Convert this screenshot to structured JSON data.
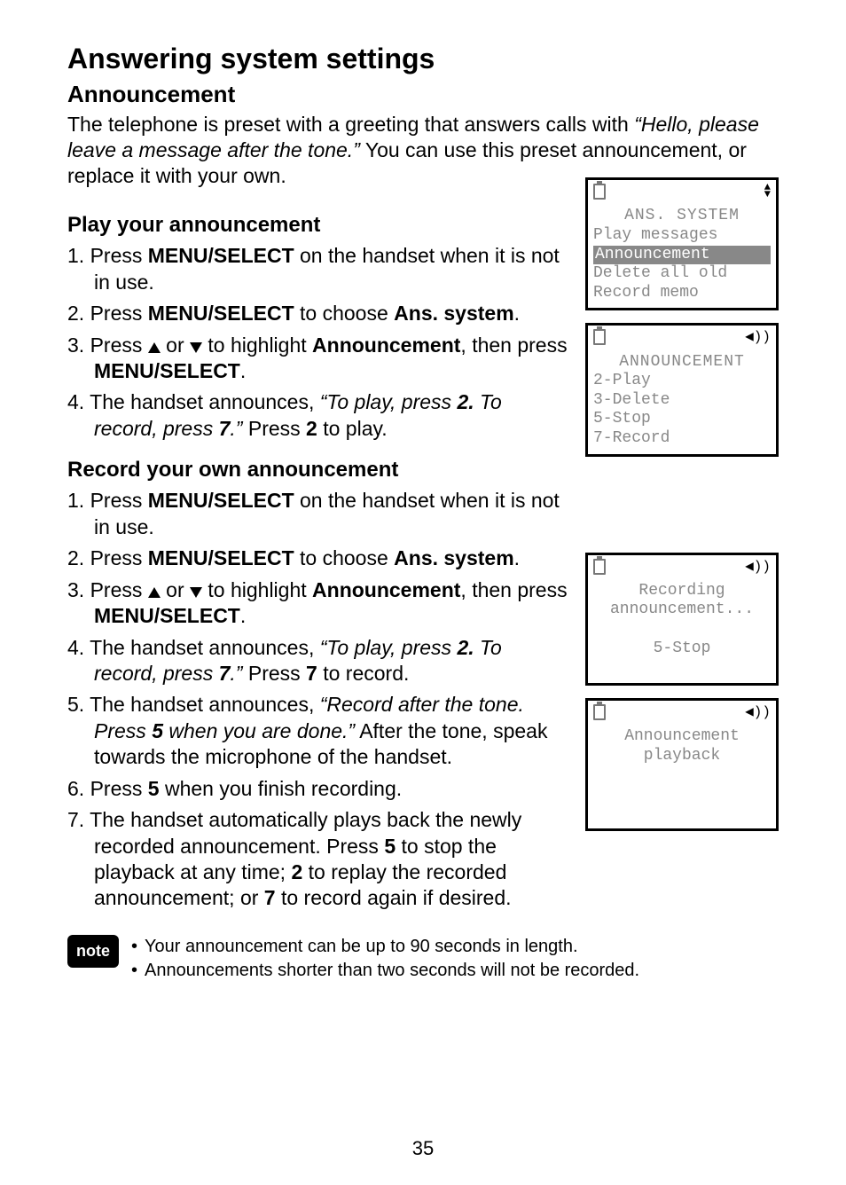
{
  "title": "Answering system settings",
  "section": "Announcement",
  "intro_pre": "The telephone is preset with a greeting that answers calls with ",
  "intro_quote": "“Hello, please leave a message after the tone.”",
  "intro_post": "  You can use this preset announcement, or replace it with your own.",
  "play": {
    "heading": "Play your announcement",
    "steps": {
      "1_pre": "1.  Press ",
      "1_b1": "MENU/",
      "1_sc": "SELECT",
      "1_post": " on the handset when it is not in use.",
      "2_pre": "2.  Press ",
      "2_sc": "MENU",
      "2_b1": "/SELECT",
      "2_mid": " to choose ",
      "2_b2": "Ans. system",
      "2_post": ".",
      "3_pre": "3.  Press  ",
      "3_or": " or ",
      "3_mid": " to highlight ",
      "3_b1": "Announcement",
      "3_post1": ", then press ",
      "3_sc": "MENU",
      "3_b2": "/SELECT",
      "3_post2": ".",
      "4_pre": "4.  The handset announces, ",
      "4_it1": "“To play, press ",
      "4_itb1": "2.",
      "4_it2": " To record, press ",
      "4_itb2": "7",
      "4_it3": ".”",
      "4_post1": "  Press ",
      "4_b1": "2",
      "4_post2": " to play."
    }
  },
  "record": {
    "heading": "Record your own announcement",
    "steps": {
      "1_pre": "1.  Press ",
      "1_b1": "MENU/",
      "1_sc": "SELECT",
      "1_post": " on the handset when it is not in use.",
      "2_pre": "2.  Press ",
      "2_sc": "MENU",
      "2_b1": "/SELECT",
      "2_mid": " to choose ",
      "2_b2": "Ans. system",
      "2_post": ".",
      "3_pre": "3.  Press  ",
      "3_or": " or ",
      "3_mid": " to highlight ",
      "3_b1": "Announcement",
      "3_post1": ", then press ",
      "3_sc": "MENU",
      "3_b2": "/SELECT",
      "3_post2": ".",
      "4_pre": "4.  The handset announces, ",
      "4_it1": "“To play, press ",
      "4_itb1": "2.",
      "4_it2": " To record, press ",
      "4_itb2": "7",
      "4_it3": ".”",
      "4_post1": "  Press ",
      "4_b1": "7",
      "4_post2": " to record.",
      "5_pre": "5.  The handset announces, ",
      "5_it1": "“Record after the tone. Press ",
      "5_itb1": "5",
      "5_it2": " when you are done.”",
      "5_post": "  After the tone, speak towards the microphone of the handset.",
      "6_pre": "6.  Press ",
      "6_b1": "5",
      "6_post": " when you finish recording.",
      "7_pre": "7.  The handset automatically plays back the newly recorded announcement. Press ",
      "7_b1": "5",
      "7_mid1": " to stop the playback at any time; ",
      "7_b2": "2",
      "7_mid2": " to replay the recorded announcement; or ",
      "7_b3": "7",
      "7_post": " to record again if desired."
    }
  },
  "note": {
    "badge": "note",
    "b1": "Your announcement can be up to 90 seconds in length.",
    "b2": "Announcements shorter than two seconds will not be recorded."
  },
  "lcd1": {
    "title": "ANS. SYSTEM",
    "r1": "Play messages",
    "r2": "Announcement",
    "r3": "Delete all old",
    "r4": "Record memo"
  },
  "lcd2": {
    "title": "ANNOUNCEMENT",
    "r1": "2-Play",
    "r2": "3-Delete",
    "r3": "5-Stop",
    "r4": "7-Record"
  },
  "lcd3": {
    "r1": "Recording",
    "r2": "announcement...",
    "r3": "5-Stop"
  },
  "lcd4": {
    "r1": "Announcement",
    "r2": "playback"
  },
  "pagenum": "35"
}
